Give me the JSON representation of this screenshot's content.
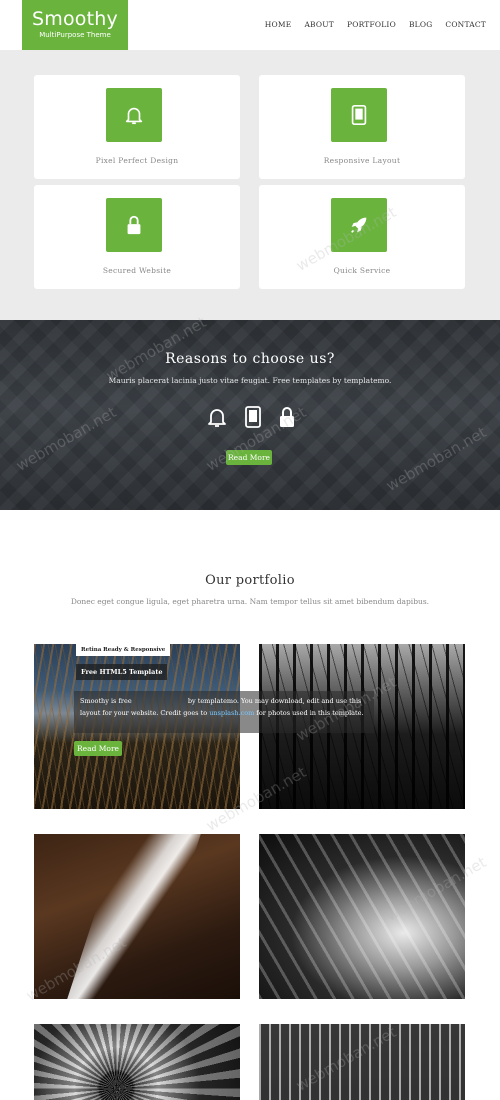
{
  "header": {
    "logo_title": "Smoothy",
    "logo_subtitle": "MultiPurpose Theme",
    "nav": [
      "HOME",
      "ABOUT",
      "PORTFOLIO",
      "BLOG",
      "CONTACT"
    ]
  },
  "features": [
    {
      "label": "Pixel Perfect Design",
      "icon": "bell-icon"
    },
    {
      "label": "Responsive Layout",
      "icon": "tablet-icon"
    },
    {
      "label": "Secured Website",
      "icon": "lock-icon"
    },
    {
      "label": "Quick Service",
      "icon": "rocket-icon"
    }
  ],
  "reasons": {
    "title": "Reasons to choose us?",
    "subtitle": "Mauris placerat lacinia justo vitae feugiat. Free templates by templatemo.",
    "icons": [
      "bell-icon",
      "tablet-icon",
      "lock-icon"
    ],
    "button": "Read More"
  },
  "portfolio": {
    "title": "Our portfolio",
    "subtitle": "Donec eget congue ligula, eget pharetra urna. Nam tempor tellus sit amet bibendum dapibus.",
    "featured": {
      "badge": "Retina Ready & Responsive",
      "title": "Free HTML5 Template",
      "desc_part1": "Smoothy is free",
      "desc_part2": "by templatemo. You may download, edit and use this layout for your website. Credit goes to",
      "desc_link": "unsplash.com",
      "desc_part3": "for photos used in this template.",
      "button": "Read More"
    }
  },
  "watermark": "webmoban.net",
  "colors": {
    "accent": "#6ab43e",
    "features_bg": "#ebebeb",
    "dark_section": "#34383c"
  }
}
